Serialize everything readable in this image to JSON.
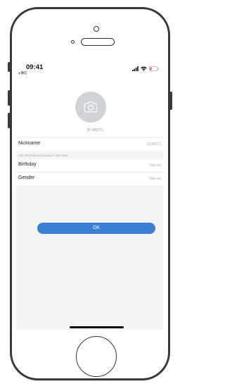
{
  "status_bar": {
    "time": "09:41",
    "carrier": "◂ 微信",
    "icons": [
      "signal-icon",
      "wifi-icon",
      "battery-icon"
    ],
    "battery_color": "#e64545"
  },
  "profile": {
    "avatar_icon": "camera-icon",
    "user_id": "ID:190271"
  },
  "fields": {
    "nickname": {
      "label": "Nickname",
      "value": "U190271"
    },
    "hint": "Add information to analyze user data",
    "birthday": {
      "label": "Birthday",
      "value": "Not set"
    },
    "gender": {
      "label": "Gender",
      "value": "Not set"
    }
  },
  "actions": {
    "ok_label": "OK",
    "accent_color": "#3a7fd2"
  }
}
